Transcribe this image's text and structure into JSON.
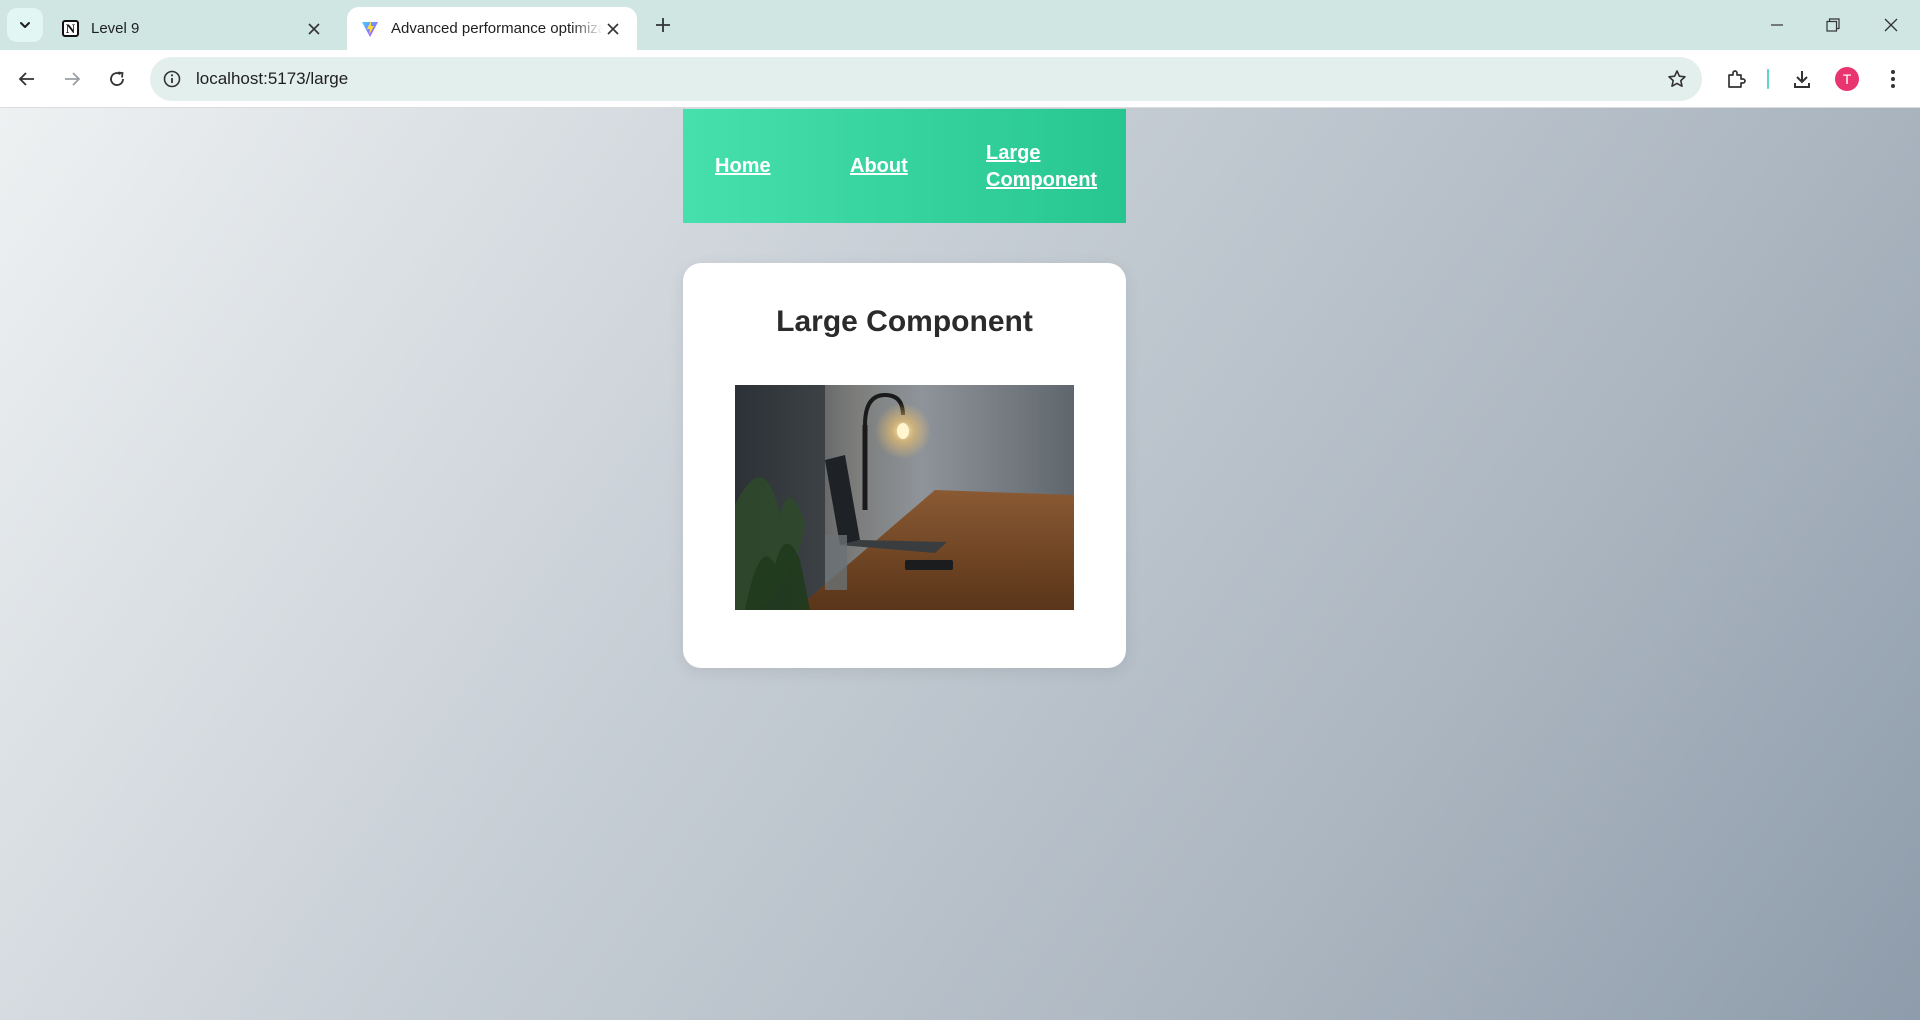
{
  "browser": {
    "tabs": [
      {
        "title": "Level 9",
        "favicon": "notion-icon",
        "active": false
      },
      {
        "title": "Advanced performance optimization",
        "favicon": "vite-icon",
        "active": true
      }
    ],
    "address": {
      "url": "localhost:5173/large"
    },
    "profile_initial": "T"
  },
  "nav": {
    "links": [
      {
        "label": "Home"
      },
      {
        "label": "About"
      },
      {
        "label": "Large Component"
      }
    ]
  },
  "main": {
    "title": "Large Component",
    "image": {
      "description_icon": "desk-lamp-laptop-photo"
    }
  }
}
